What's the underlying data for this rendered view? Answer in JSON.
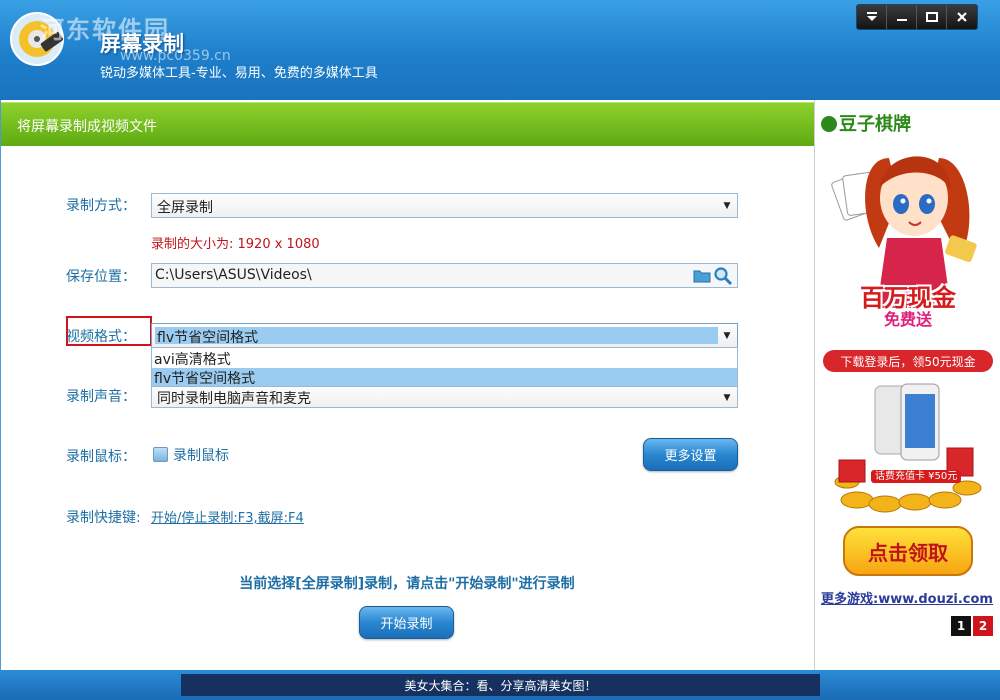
{
  "titlebar": {
    "watermark": "河东软件园",
    "watermark_url": "www.pc0359.cn",
    "app_title": "屏幕录制",
    "subtitle": "锐动多媒体工具-专业、易用、免费的多媒体工具",
    "controls": [
      "menu-icon",
      "minimize-icon",
      "maximize-icon",
      "close-icon"
    ]
  },
  "panel": {
    "header": "将屏幕录制成视频文件",
    "record_mode": {
      "label": "录制方式：",
      "value": "全屏录制"
    },
    "record_size": "录制的大小为: 1920 x 1080",
    "save_path": {
      "label": "保存位置：",
      "value": "C:\\Users\\ASUS\\Videos\\"
    },
    "video_format": {
      "label": "视频格式：",
      "value": "flv节省空间格式",
      "options": [
        "avi高清格式",
        "flv节省空间格式"
      ]
    },
    "record_audio": {
      "label": "录制声音：",
      "value": "同时录制电脑声音和麦克"
    },
    "record_mouse": {
      "label": "录制鼠标：",
      "checkbox_label": "录制鼠标",
      "checked": false
    },
    "more_settings": "更多设置",
    "hotkey": {
      "label": "录制快捷键:",
      "value": "开始/停止录制:F3,截屏:F4"
    },
    "status_message": "当前选择[全屏录制]录制，请点击\"开始录制\"进行录制",
    "start_button": "开始录制"
  },
  "ad": {
    "brand": "豆子棋牌",
    "prize_text": "百万现金",
    "prize_sub": "免费送",
    "download_bar": "下载登录后，领50元现金",
    "coin_badge": "话费充值卡 ¥50元",
    "claim_button": "点击领取",
    "more_games": "更多游戏:www.douzi.com",
    "pages": [
      "1",
      "2"
    ]
  },
  "bottom": {
    "ad_text": "美女大集合：看、分享高清美女图！"
  },
  "colors": {
    "accent_blue": "#1e7fcb",
    "header_green": "#6ab81a",
    "label_blue": "#1d6fa5",
    "warning_red": "#c0141b"
  }
}
